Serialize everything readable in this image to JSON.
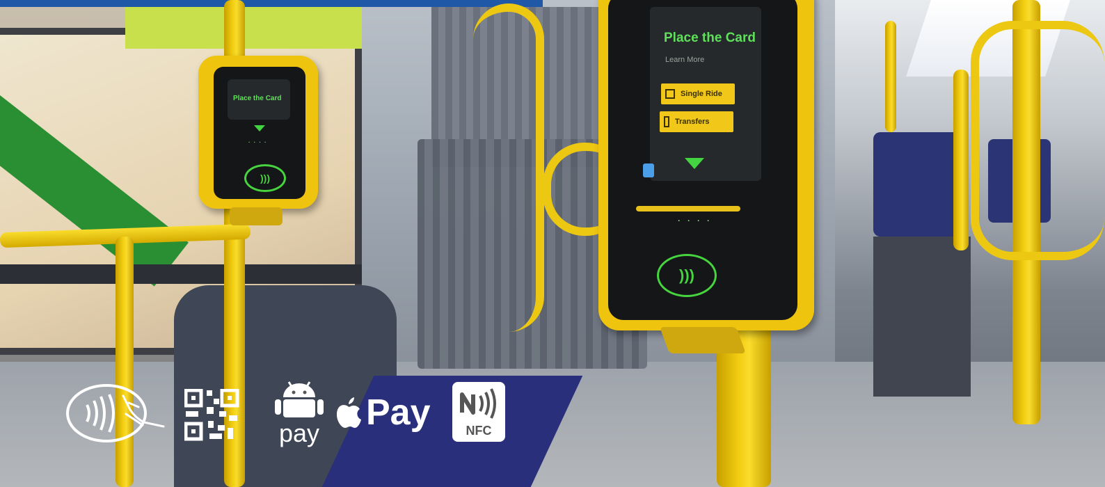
{
  "scene": {
    "description_colors": {
      "accent_yellow": "#efc40f",
      "screen_green": "#46d43f",
      "top_bar_blue": "#1e58a6"
    }
  },
  "validator_large": {
    "title": "Place the Card",
    "subtitle": "Learn More",
    "button_1": "Single Ride",
    "button_2": "Transfers"
  },
  "validator_small": {
    "title": "Place the Card"
  },
  "payment_icons": {
    "contactless": "contactless-icon",
    "qr": "qr-code-icon",
    "android_pay_label": "pay",
    "apple_pay_label": "Pay",
    "nfc_label": "NFC"
  }
}
